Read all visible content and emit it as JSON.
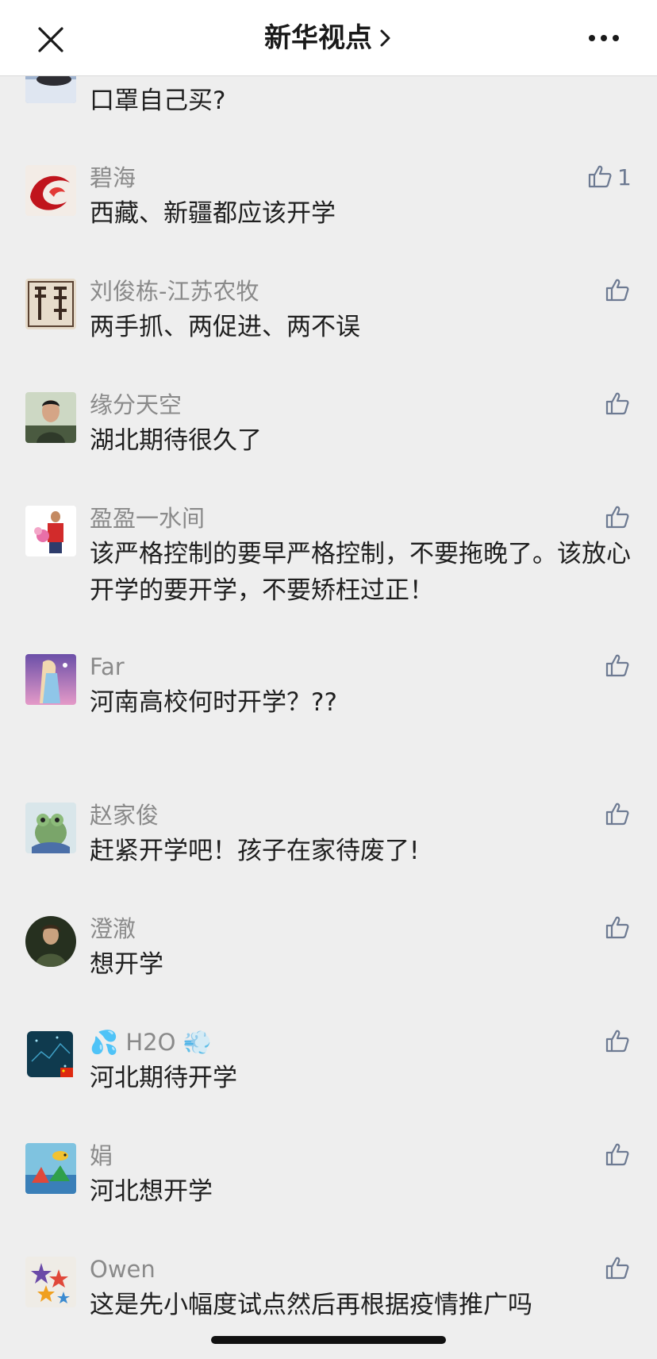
{
  "header": {
    "title": "新华视点",
    "close_icon": "close-icon",
    "chevron_icon": "chevron-right-icon",
    "more_icon": "more-horizontal-icon"
  },
  "comments": [
    {
      "name": "",
      "text": "口罩自己买?",
      "likes": "",
      "avatar": "landscape-avatar"
    },
    {
      "name": "碧海",
      "text": "西藏、新疆都应该开学",
      "likes": "1",
      "avatar": "red-swirl-avatar"
    },
    {
      "name": "刘俊栋-江苏农牧",
      "text": "两手抓、两促进、两不误",
      "likes": "",
      "avatar": "calligraphy-avatar"
    },
    {
      "name": "缘分天空",
      "text": "湖北期待很久了",
      "likes": "",
      "avatar": "man-photo-avatar"
    },
    {
      "name": "盈盈一水间",
      "text": "该严格控制的要早严格控制，不要拖晚了。该放心开学的要开学，不要矫枉过正！",
      "likes": "",
      "avatar": "person-flowers-avatar"
    },
    {
      "name": "Far",
      "text": "河南高校何时开学？??",
      "likes": "",
      "avatar": "princess-avatar"
    },
    {
      "name": "赵家俊",
      "text": "赶紧开学吧！孩子在家待废了!",
      "likes": "",
      "avatar": "frog-avatar"
    },
    {
      "name": "澄澈",
      "text": "想开学",
      "likes": "",
      "avatar": "dark-portrait-avatar"
    },
    {
      "name": "💦 H2O 💨",
      "text": "河北期待开学",
      "likes": "",
      "avatar": "night-sky-avatar"
    },
    {
      "name": "娟",
      "text": "河北想开学",
      "likes": "",
      "avatar": "cartoon-fish-avatar"
    },
    {
      "name": "Owen",
      "text": "这是先小幅度试点然后再根据疫情推广吗",
      "likes": "",
      "avatar": "stars-avatar"
    }
  ],
  "colors": {
    "background": "#eeeeee",
    "header_bg": "#ffffff",
    "name_color": "#8a8a8a",
    "like_color": "#6d7a92"
  }
}
